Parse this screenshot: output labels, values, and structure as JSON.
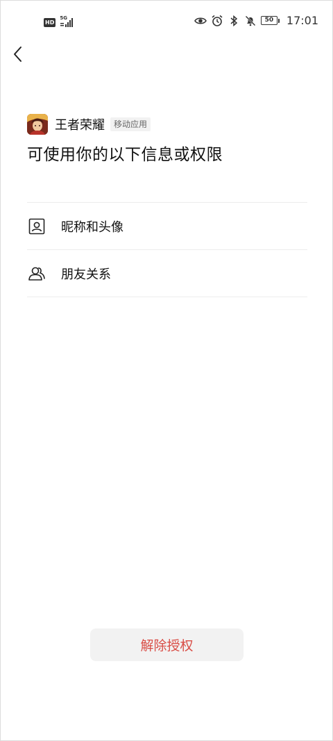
{
  "status_bar": {
    "hd_label": "HD",
    "network_label": "5G",
    "battery_level": "50",
    "time": "17:01"
  },
  "app": {
    "name": "王者荣耀",
    "tag": "移动应用"
  },
  "page": {
    "title": "可使用你的以下信息或权限"
  },
  "permissions": [
    {
      "label": "昵称和头像",
      "icon": "profile-card-icon"
    },
    {
      "label": "朋友关系",
      "icon": "friends-icon"
    }
  ],
  "actions": {
    "revoke_label": "解除授权"
  },
  "colors": {
    "accent_red": "#d94e47",
    "button_bg": "#f2f2f2",
    "divider": "#ececec"
  }
}
